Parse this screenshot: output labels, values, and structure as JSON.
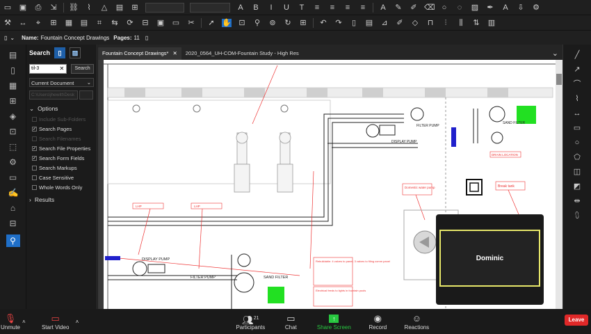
{
  "namebar": {
    "name_label": "Name:",
    "name_value": "Fountain Concept Drawings",
    "pages_label": "Pages:",
    "pages_value": "11"
  },
  "search_panel": {
    "title": "Search",
    "query": "til-3",
    "search_button": "Search",
    "scope": "Current Document",
    "placeholder": "C:\\Users\\jhewitt\\Desk",
    "options_header": "Options",
    "options": [
      {
        "label": "Include Sub-Folders",
        "checked": false,
        "enabled": false
      },
      {
        "label": "Search Pages",
        "checked": true,
        "enabled": true
      },
      {
        "label": "Search Filenames",
        "checked": false,
        "enabled": false
      },
      {
        "label": "Search File Properties",
        "checked": true,
        "enabled": true
      },
      {
        "label": "Search Form Fields",
        "checked": true,
        "enabled": true
      },
      {
        "label": "Search Markups",
        "checked": false,
        "enabled": true
      },
      {
        "label": "Case Sensitive",
        "checked": false,
        "enabled": true
      },
      {
        "label": "Whole Words Only",
        "checked": false,
        "enabled": true
      }
    ],
    "results_header": "Results"
  },
  "tabs": [
    {
      "label": "Fountain Concept Drawings*",
      "active": true
    },
    {
      "label": "2020_0564_UH-COM-Fountain Study - High Res",
      "active": false
    }
  ],
  "drawing": {
    "labels": {
      "filter_pump_top": "FILTER PUMP",
      "sand_filter_top": "SAND FILTER",
      "display_pump_top": "DISPLAY PUMP",
      "display_pump_bottom": "DISPLAY PUMP",
      "filter_pump_bottom": "FILTER PUMP",
      "sand_filter_bottom": "SAND FILTER",
      "drain_location": "DRAIN LOCATION",
      "domestic_water_pump": "Domestic water pump",
      "break_tank": "Break tank",
      "red_label_1": "LHP",
      "red_label_2": "LHP"
    },
    "notes": [
      "Rebuildable: 4 valves to panel; 3 valves to filing comm panel",
      "Electrical feeds to lights in fountain pools"
    ]
  },
  "video_popup": {
    "name": "Dominic"
  },
  "meeting": {
    "unmute": "Unmute",
    "start_video": "Start Video",
    "participants": "Participants",
    "participants_count": "21",
    "chat": "Chat",
    "share_screen": "Share Screen",
    "record": "Record",
    "reactions": "Reactions",
    "leave": "Leave"
  },
  "colors": {
    "share_green": "#28c840",
    "leave_red": "#e02828",
    "accent_blue": "#1f6fc8",
    "popup_border": "#e8e86a"
  }
}
